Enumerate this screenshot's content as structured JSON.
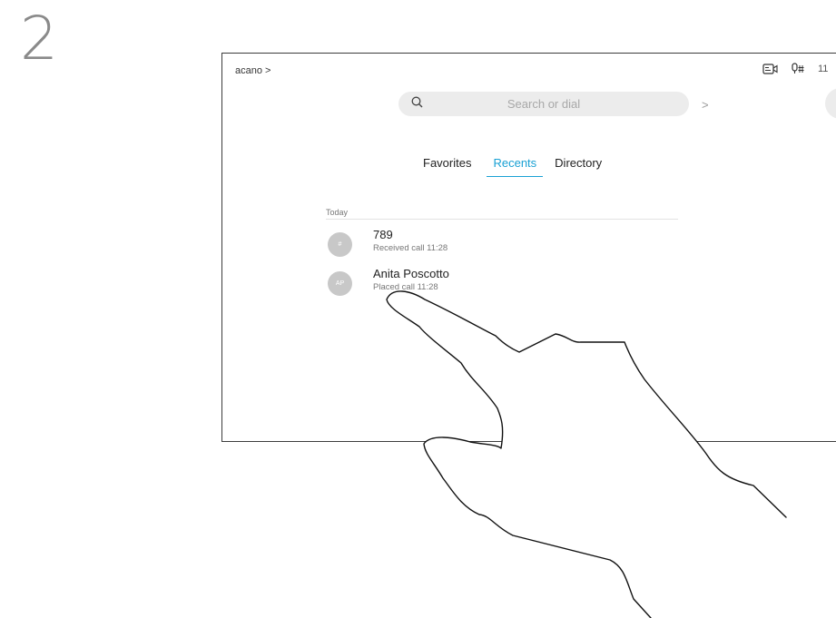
{
  "step": {
    "number": "2"
  },
  "header": {
    "brand": "acano >",
    "time": "11"
  },
  "search": {
    "placeholder": "Search or dial",
    "chevron": ">"
  },
  "tabs": [
    {
      "label": "Favorites",
      "active": false
    },
    {
      "label": "Recents",
      "active": true
    },
    {
      "label": "Directory",
      "active": false
    }
  ],
  "recents": {
    "section_label": "Today",
    "items": [
      {
        "avatar": "#",
        "name": "789",
        "detail": "Received call 11:28"
      },
      {
        "avatar": "AP",
        "name": "Anita Poscotto",
        "detail": "Placed call 11:28"
      }
    ]
  },
  "colors": {
    "accent": "#1aa1d4",
    "avatar": "#c8c8c8",
    "search_bg": "#ececec"
  },
  "icons": {
    "search": "search-icon",
    "camera": "camera-icon",
    "mic_off": "microphone-off-icon",
    "hand": "hand-gesture-icon"
  }
}
